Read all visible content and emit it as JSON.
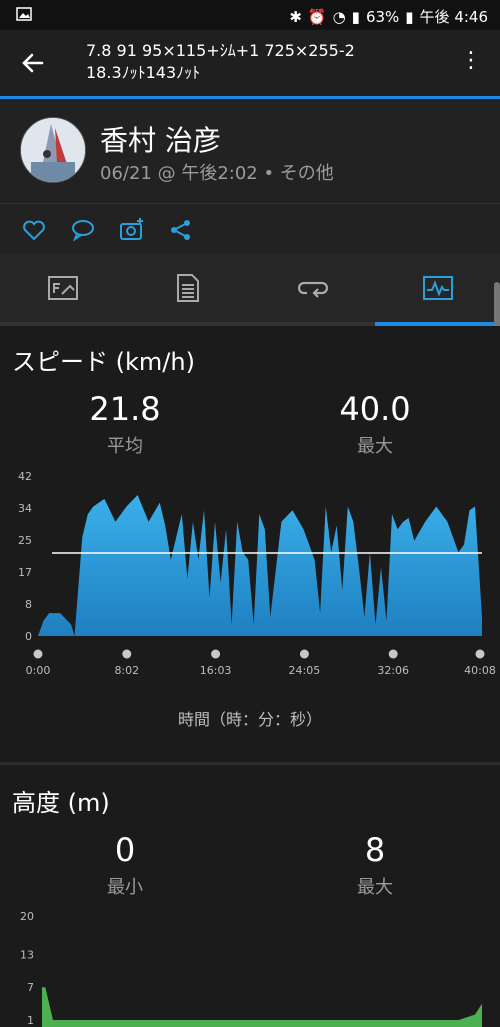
{
  "status": {
    "battery": "63%",
    "time": "午後 4:46"
  },
  "header": {
    "title_line1": "7.8 91 95×115+ｼﾑ+1 725×255-2",
    "title_line2": "18.3ﾉｯﾄ143ﾉｯﾄ"
  },
  "profile": {
    "name": "香村 治彦",
    "meta": "06/21 @ 午後2:02 • その他"
  },
  "icons": {
    "back": "arrow-left-icon",
    "menu": "more-vert-icon",
    "like": "heart-icon",
    "comment": "comment-icon",
    "photo": "camera-add-icon",
    "share": "share-icon",
    "tab1": "overview-icon",
    "tab2": "details-icon",
    "tab3": "laps-icon",
    "tab4": "charts-icon"
  },
  "speed": {
    "title": "スピード (km/h)",
    "avg_value": "21.8",
    "avg_label": "平均",
    "max_value": "40.0",
    "max_label": "最大"
  },
  "elevation": {
    "title": "高度 (m)",
    "min_value": "0",
    "min_label": "最小",
    "max_value": "8",
    "max_label": "最大"
  },
  "chart_data": [
    {
      "type": "area",
      "title": "",
      "xlabel": "時間（時：分：秒）",
      "ylabel": "",
      "y_ticks": [
        "0",
        "8",
        "17",
        "25",
        "34",
        "42"
      ],
      "x_ticks": [
        "0:00",
        "8:02",
        "16:03",
        "24:05",
        "32:06",
        "40:08"
      ],
      "ylim": [
        0,
        42
      ],
      "xlim_minutes": [
        0,
        40.13
      ],
      "average_line": 21.8,
      "color": "#2b9fd9",
      "x_minutes": [
        0,
        0.5,
        1,
        2,
        3,
        3.3,
        4,
        4.5,
        5,
        6,
        7,
        8,
        9,
        10,
        11,
        11.5,
        12,
        13,
        13.5,
        14,
        14.5,
        15,
        15.5,
        16,
        16.5,
        17,
        17.5,
        18,
        18.5,
        19,
        19.5,
        20,
        20.5,
        21,
        22,
        23,
        24,
        25,
        25.5,
        26,
        26.5,
        27,
        27.5,
        28,
        28.5,
        29,
        29.5,
        30,
        30.5,
        31,
        31.5,
        32,
        32.5,
        33,
        33.5,
        34,
        35,
        36,
        37,
        38,
        38.5,
        39,
        39.5,
        40.13
      ],
      "values": [
        0,
        4,
        6,
        6,
        3,
        0,
        26,
        32,
        34,
        36,
        30,
        34,
        37,
        30,
        35,
        29,
        20,
        32,
        15,
        30,
        20,
        33,
        10,
        30,
        14,
        28,
        3,
        30,
        22,
        20,
        3,
        32,
        28,
        5,
        30,
        33,
        28,
        20,
        6,
        34,
        22,
        29,
        12,
        34,
        30,
        18,
        5,
        22,
        3,
        18,
        4,
        32,
        28,
        30,
        31,
        25,
        30,
        34,
        30,
        22,
        24,
        33,
        34,
        5
      ]
    },
    {
      "type": "area",
      "title": "",
      "y_ticks": [
        "1",
        "7",
        "13",
        "20"
      ],
      "ylim": [
        1,
        20
      ],
      "color": "#4caf50",
      "x_minutes": [
        0,
        0.3,
        1,
        38,
        39.5,
        40.13
      ],
      "values": [
        7,
        7,
        1,
        1,
        2,
        4
      ]
    }
  ]
}
